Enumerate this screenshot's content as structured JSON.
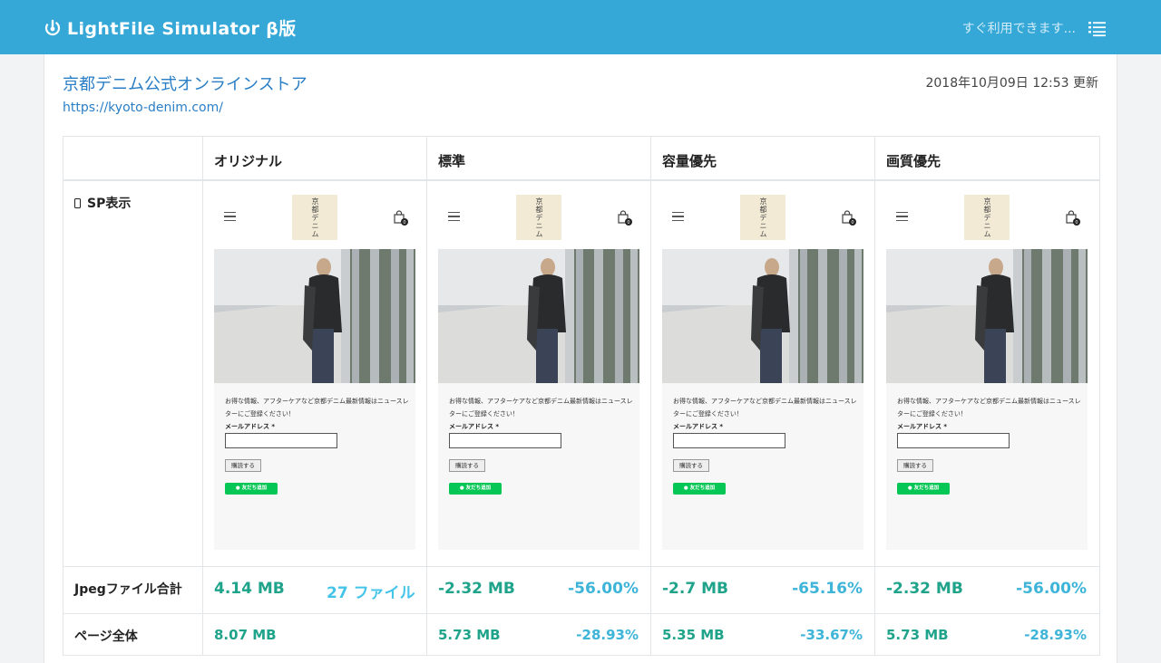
{
  "header": {
    "app_title": "LightFile Simulator β版",
    "status_text": "すぐ利用できます..."
  },
  "site": {
    "name": "京都デニム公式オンラインストア",
    "url": "https://kyoto-denim.com/",
    "updated": "2018年10月09日 12:53 更新"
  },
  "table": {
    "columns": [
      "オリジナル",
      "標準",
      "容量優先",
      "画質優先"
    ],
    "rows": {
      "sp_view": "SP表示",
      "jpeg_total": "Jpegファイル合計",
      "page_total": "ページ全体"
    }
  },
  "preview": {
    "brand_text": "京都デニム",
    "cart_count": "0",
    "newsletter_text": "お得な情報、アフターケアなど京都デニム最新情報はニュースレターにご登録ください！",
    "email_label": "メールアドレス *",
    "subscribe_label": "購読する",
    "line_label": "友だち追加"
  },
  "results": {
    "jpeg": [
      {
        "size": "4.14 MB",
        "extra": "27 ファイル"
      },
      {
        "size": "-2.32 MB",
        "extra": "-56.00%"
      },
      {
        "size": "-2.7 MB",
        "extra": "-65.16%"
      },
      {
        "size": "-2.32 MB",
        "extra": "-56.00%"
      }
    ],
    "page": [
      {
        "size": "8.07 MB",
        "extra": ""
      },
      {
        "size": "5.73 MB",
        "extra": "-28.93%"
      },
      {
        "size": "5.35 MB",
        "extra": "-33.67%"
      },
      {
        "size": "5.73 MB",
        "extra": "-28.93%"
      }
    ]
  },
  "colors": {
    "header_bg": "#35a8d8",
    "link": "#2a7ec5",
    "size_green": "#1fa38a",
    "percent_blue": "#3db4d8"
  },
  "icons": {
    "logo": "power-swirl-icon",
    "menu": "list-icon",
    "phone": "smartphone-icon",
    "hamburger": "hamburger-icon",
    "cart": "shopping-bag-icon",
    "line": "line-chat-icon"
  }
}
